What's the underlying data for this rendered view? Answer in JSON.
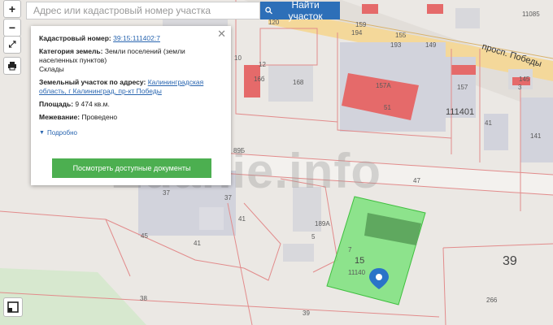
{
  "search": {
    "placeholder": "Адрес или кадастровый номер участка",
    "button_label": "Найти участок"
  },
  "controls": {
    "zoom_in": "+",
    "zoom_out": "−"
  },
  "popup": {
    "cad_label": "Кадастровый номер:",
    "cad_value": "39:15:111402:7",
    "cat_label": "Категория земель:",
    "cat_value": "Земли поселений (земли населенных пунктов)",
    "use_value": "Склады",
    "addr_label": "Земельный участок по адресу:",
    "addr_value": "Калининградская область, г Калининград, пр-кт Победы",
    "area_label": "Площадь:",
    "area_value": "9 474 кв.м.",
    "survey_label": "Межевание:",
    "survey_value": "Проведено",
    "more_label": "Подробно",
    "docs_button": "Посмотреть доступные документы"
  },
  "watermark": "Zdanie.info",
  "map_labels": {
    "street": "просп. Победы",
    "l_11085": "11085",
    "l_159": "159",
    "l_194": "194",
    "l_155": "155",
    "l_149": "149",
    "l_193": "193",
    "l_120": "120",
    "l_10": "10",
    "l_12": "12",
    "l_16b": "16б",
    "l_168": "168",
    "l_157a": "157А",
    "l_51": "51",
    "l_157": "157",
    "l_145": "145",
    "l_3": "3",
    "l_111401": "111401",
    "l_41a": "41",
    "l_141": "141",
    "l_89b": "89Б",
    "l_47": "47",
    "l_37a": "37",
    "l_37b": "37",
    "l_41b": "41",
    "l_45": "45",
    "l_41c": "41",
    "l_189a": "189А",
    "l_5": "5",
    "l_7": "7",
    "l_15": "15",
    "l_11140": "11140",
    "l_39big": "39",
    "l_39": "39",
    "l_38": "38",
    "l_266": "266"
  }
}
